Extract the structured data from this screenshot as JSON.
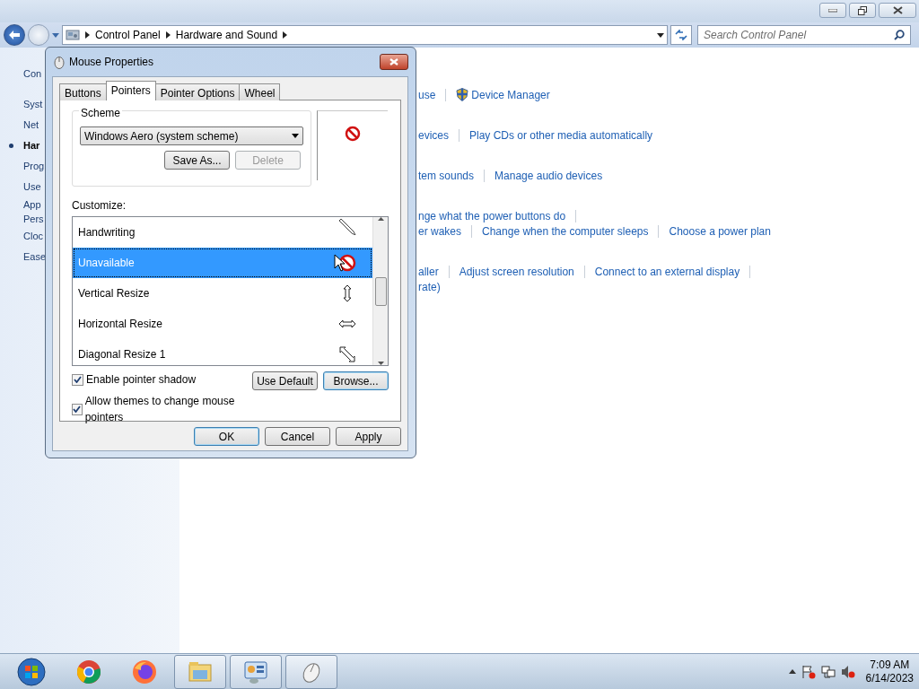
{
  "explorer": {
    "breadcrumb": [
      "Control Panel",
      "Hardware and Sound"
    ],
    "search": {
      "placeholder": "Search Control Panel"
    },
    "sidebar": [
      {
        "label": "Con",
        "selected": false
      },
      {
        "label": "Syst",
        "selected": false
      },
      {
        "label": "Net",
        "selected": false
      },
      {
        "label": "Har",
        "selected": true
      },
      {
        "label": "Prog",
        "selected": false
      },
      {
        "label": "Use",
        "selected": false
      },
      {
        "label": "App",
        "selected": false
      },
      {
        "label": "Pers",
        "selected": false
      },
      {
        "label": "Cloc",
        "selected": false
      },
      {
        "label": "Ease",
        "selected": false
      }
    ],
    "sections": [
      {
        "lines": [
          {
            "links": [
              "use",
              {
                "text": "Device Manager",
                "shield": true
              }
            ]
          }
        ]
      },
      {
        "lines": [
          {
            "links": [
              "evices",
              "Play CDs or other media automatically"
            ]
          }
        ]
      },
      {
        "lines": [
          {
            "links": [
              "tem sounds",
              "Manage audio devices"
            ]
          }
        ]
      },
      {
        "lines": [
          {
            "links": [
              "nge what the power buttons do"
            ],
            "trailing_separator": true
          },
          {
            "links": [
              "er wakes",
              "Change when the computer sleeps",
              "Choose a power plan"
            ]
          }
        ]
      },
      {
        "lines": [
          {
            "links": [
              "aller",
              "Adjust screen resolution",
              "Connect to an external display"
            ],
            "trailing_separator": true
          },
          {
            "links": [
              "rate)"
            ]
          }
        ]
      }
    ]
  },
  "dialog": {
    "title": "Mouse Properties",
    "tabs": [
      {
        "label": "Buttons",
        "selected": false
      },
      {
        "label": "Pointers",
        "selected": true
      },
      {
        "label": "Pointer Options",
        "selected": false
      },
      {
        "label": "Wheel",
        "selected": false
      }
    ],
    "scheme": {
      "legend": "Scheme",
      "value": "Windows Aero (system scheme)",
      "buttons": [
        {
          "label": "Save As...",
          "disabled": false
        },
        {
          "label": "Delete",
          "disabled": true
        }
      ]
    },
    "customize_label": "Customize:",
    "pointers": [
      {
        "label": "Handwriting",
        "kind": "pen",
        "selected": false
      },
      {
        "label": "Unavailable",
        "kind": "unavailable",
        "selected": true
      },
      {
        "label": "Vertical Resize",
        "kind": "vresize",
        "selected": false
      },
      {
        "label": "Horizontal Resize",
        "kind": "hresize",
        "selected": false
      },
      {
        "label": "Diagonal Resize 1",
        "kind": "dresize",
        "selected": false
      }
    ],
    "checkboxes": [
      {
        "label": "Enable pointer shadow",
        "checked": true
      },
      {
        "label": "Allow themes to change mouse pointers",
        "checked": true
      }
    ],
    "side_buttons": [
      "Use Default",
      "Browse..."
    ],
    "buttons": [
      "OK",
      "Cancel",
      "Apply"
    ]
  },
  "taskbar": {
    "apps": [
      {
        "kind": "chrome",
        "active": false
      },
      {
        "kind": "firefox",
        "active": false
      },
      {
        "kind": "folder",
        "active": true
      },
      {
        "kind": "panel",
        "active": true
      },
      {
        "kind": "mouse",
        "active": true
      }
    ],
    "time": "7:09 AM",
    "date": "6/14/2023"
  }
}
